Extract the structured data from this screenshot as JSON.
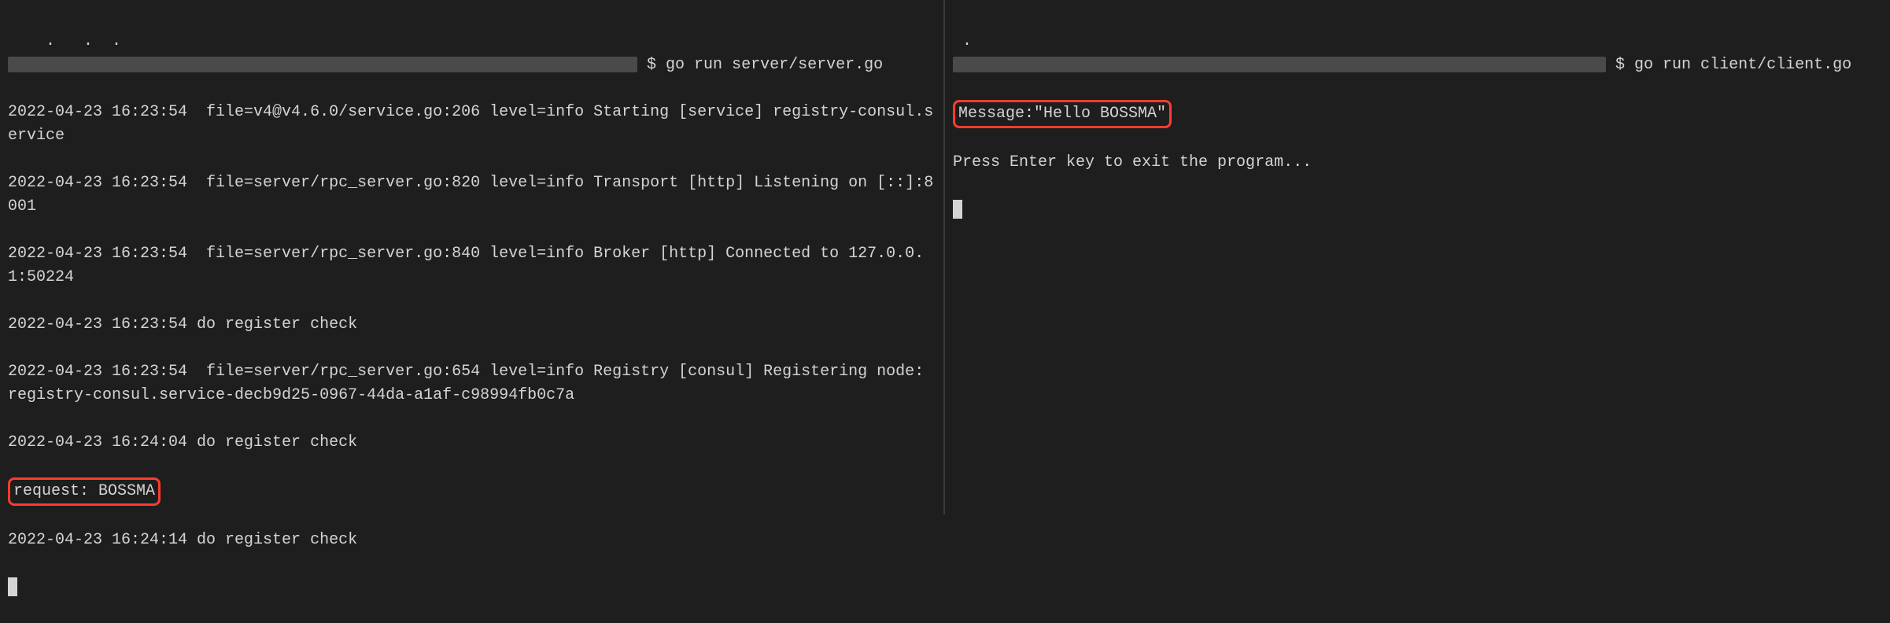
{
  "left": {
    "prompt_symbol": "$",
    "command": "go run server/server.go",
    "lines": [
      "2022-04-23 16:23:54  file=v4@v4.6.0/service.go:206 level=info Starting [service] registry-consul.service",
      "2022-04-23 16:23:54  file=server/rpc_server.go:820 level=info Transport [http] Listening on [::]:8001",
      "2022-04-23 16:23:54  file=server/rpc_server.go:840 level=info Broker [http] Connected to 127.0.0.1:50224",
      "2022-04-23 16:23:54 do register check",
      "2022-04-23 16:23:54  file=server/rpc_server.go:654 level=info Registry [consul] Registering node: registry-consul.service-decb9d25-0967-44da-a1af-c98994fb0c7a",
      "2022-04-23 16:24:04 do register check"
    ],
    "highlight": "request: BOSSMA",
    "after_highlight": "2022-04-23 16:24:14 do register check"
  },
  "right": {
    "prompt_symbol": "$",
    "command": "go run client/client.go",
    "highlight": "Message:\"Hello BOSSMA\"",
    "after_highlight": "Press Enter key to exit the program..."
  }
}
